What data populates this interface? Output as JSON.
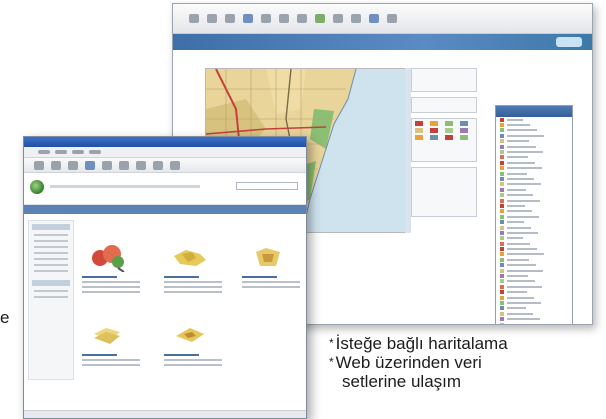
{
  "captions": {
    "left_fragment": "e",
    "line1": "İsteğe bağlı haritalama",
    "line2": "Web üzerinden veri",
    "line3": "setlerine ulaşım",
    "bullet_symbol": "*"
  },
  "icons": [
    "toolbar-icons",
    "globe-logo-icon",
    "search-field",
    "people-icon",
    "map-icon",
    "folder-icon",
    "layers-icon",
    "chart-icon"
  ],
  "colors": {
    "titlebar_blue": "#2a5cb4",
    "banner_blue": "#4a7bb8",
    "map_water": "#cfe3ef",
    "map_land": "#e9d49a",
    "map_green": "#8bbf73",
    "map_road_red": "#c4413a"
  }
}
